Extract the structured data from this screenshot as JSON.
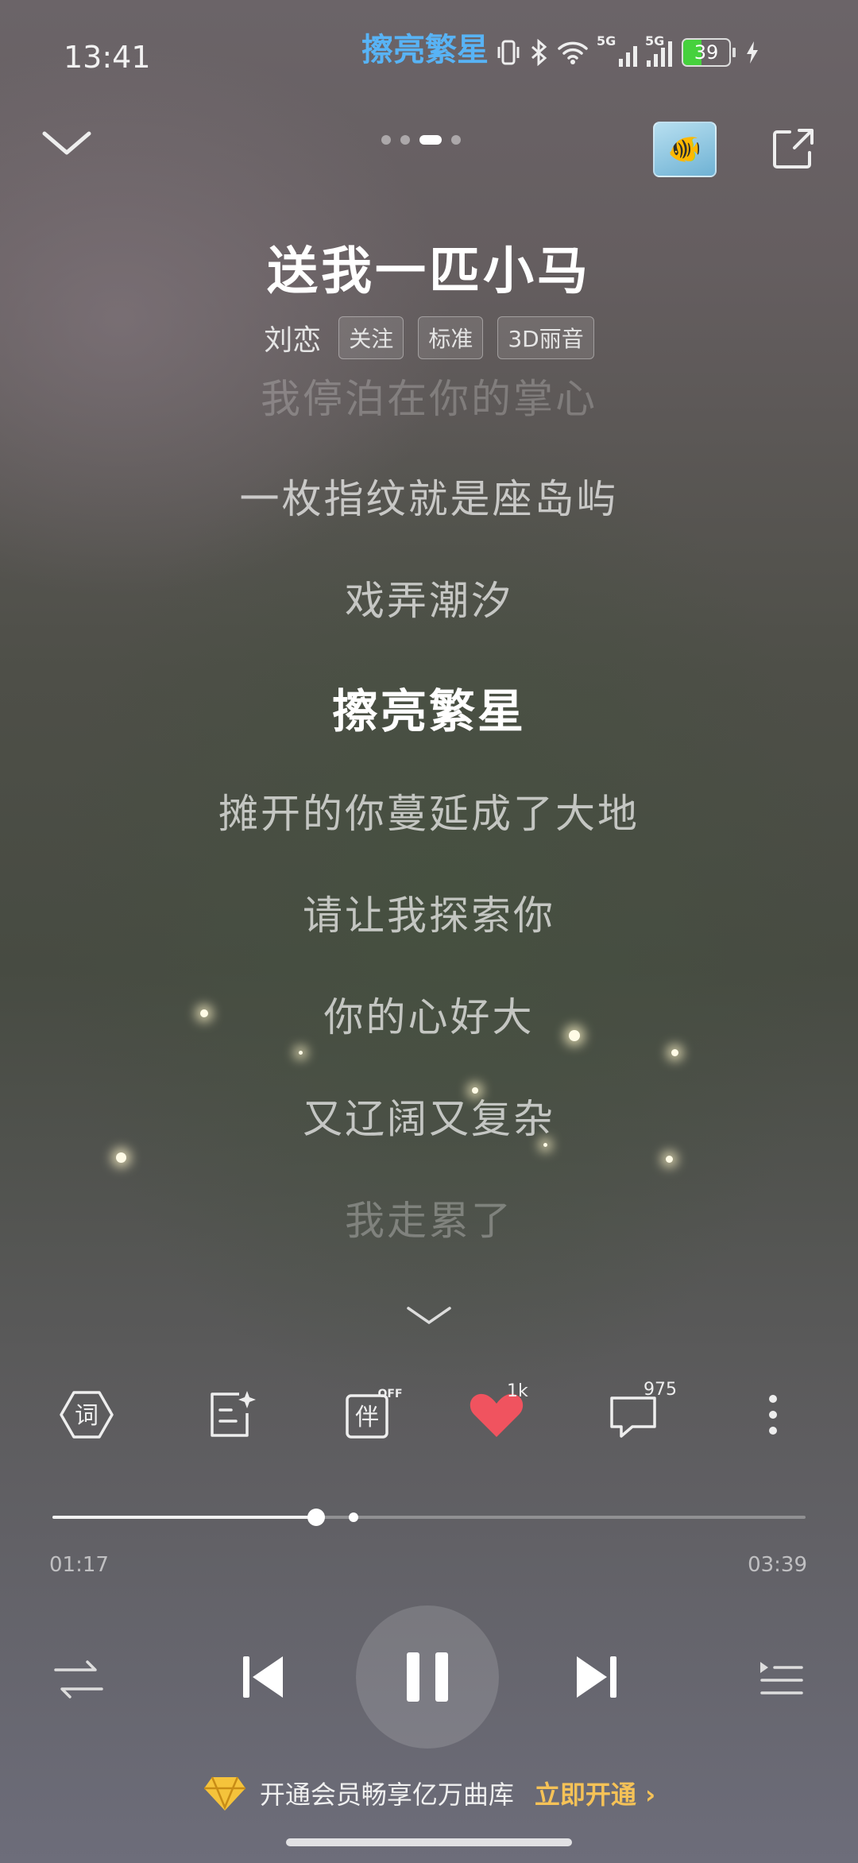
{
  "status_bar": {
    "time": "13:41",
    "now_playing_lyric": "擦亮繁星",
    "network_1": "5G",
    "network_2": "5G",
    "battery": "39"
  },
  "header": {
    "page_dots_count": 4,
    "active_page_index": 2,
    "cover_icon": "goldfish-icon"
  },
  "song": {
    "title": "送我一匹小马",
    "artist": "刘恋",
    "follow_label": "关注",
    "quality_label": "标准",
    "sound_effect_label": "3D丽音"
  },
  "lyrics": [
    "我停泊在你的掌心",
    "一枚指纹就是座岛屿",
    "戏弄潮汐",
    "擦亮繁星",
    "摊开的你蔓延成了大地",
    "请让我探索你",
    "你的心好大",
    "又辽阔又复杂",
    "我走累了"
  ],
  "current_lyric_index": 3,
  "actions": {
    "lyrics_icon_label": "词",
    "accompany_icon_label": "伴",
    "accompany_state": "OFF",
    "like_count": "1k",
    "comment_count": "975",
    "like_color": "#f0535f"
  },
  "progress": {
    "elapsed": "01:17",
    "total": "03:39",
    "fraction": 0.35,
    "marker_fraction": 0.4
  },
  "vip": {
    "text": "开通会员畅享亿万曲库",
    "cta": "立即开通",
    "icon": "diamond-vip-icon"
  }
}
